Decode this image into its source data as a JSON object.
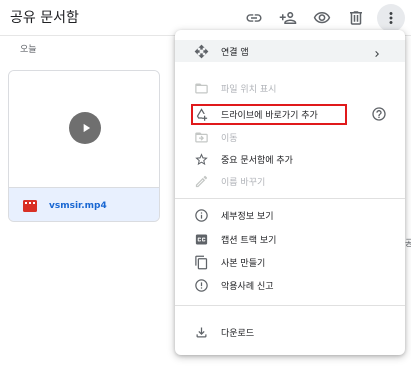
{
  "header": {
    "title": "공유 문서함",
    "icons": [
      "link-icon",
      "add-person-icon",
      "preview-eye-icon",
      "trash-icon",
      "more-vert-icon"
    ]
  },
  "section": {
    "label": "오늘"
  },
  "file": {
    "name": "vsmsir.mp4",
    "type_icon": "video-file-icon",
    "thumb_icon": "play-icon"
  },
  "edge_char": "공",
  "menu": {
    "items": [
      {
        "label": "연결 앱",
        "icon": "move-arrows-icon",
        "has_submenu": true
      },
      {
        "label": "파일 위치 표시",
        "icon": "folder-icon",
        "disabled": true
      },
      {
        "label": "드라이브에 바로가기 추가",
        "icon": "add-shortcut-icon",
        "highlighted": true
      },
      {
        "label": "이동",
        "icon": "move-to-folder-icon",
        "disabled": true
      },
      {
        "label": "중요 문서함에 추가",
        "icon": "star-icon"
      },
      {
        "label": "이름 바꾸기",
        "icon": "pencil-icon",
        "disabled": true
      },
      {
        "label": "세부정보 보기",
        "icon": "info-icon"
      },
      {
        "label": "캡션 트랙 보기",
        "icon": "cc-icon"
      },
      {
        "label": "사본 만들기",
        "icon": "copy-icon"
      },
      {
        "label": "악용사례 신고",
        "icon": "report-icon"
      },
      {
        "label": "다운로드",
        "icon": "download-icon"
      }
    ]
  },
  "colors": {
    "highlight_box": "#e0191b",
    "accent": "#1967d2",
    "selected_bg": "#e8f0fe"
  }
}
